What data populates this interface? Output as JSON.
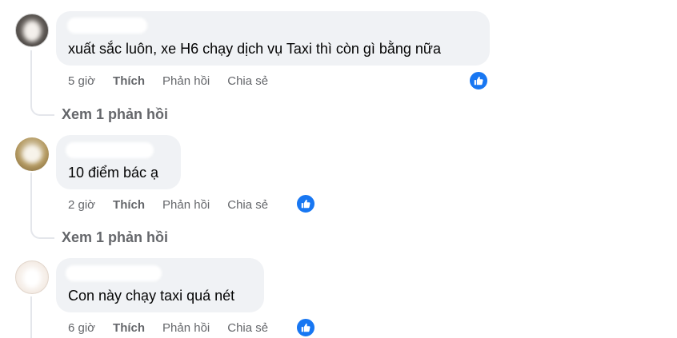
{
  "colors": {
    "bubble": "#f0f2f5",
    "meta_text": "#65676b",
    "like_blue": "#1877f2",
    "thread_line": "#e4e6eb"
  },
  "comments": [
    {
      "text": "xuất sắc luôn, xe H6 chạy dịch vụ Taxi thì còn gì bằng nữa",
      "time": "5 giờ",
      "like_label": "Thích",
      "reply_label": "Phản hồi",
      "share_label": "Chia sẻ",
      "reaction_icon": "like-thumb-icon",
      "view_replies": "Xem 1 phản hồi"
    },
    {
      "text": "10 điểm bác ạ",
      "time": "2 giờ",
      "like_label": "Thích",
      "reply_label": "Phản hồi",
      "share_label": "Chia sẻ",
      "reaction_icon": "like-thumb-icon",
      "view_replies": "Xem 1 phản hồi"
    },
    {
      "text": "Con này chạy taxi quá nét",
      "time": "6 giờ",
      "like_label": "Thích",
      "reply_label": "Phản hồi",
      "share_label": "Chia sẻ",
      "reaction_icon": "like-thumb-icon"
    }
  ]
}
